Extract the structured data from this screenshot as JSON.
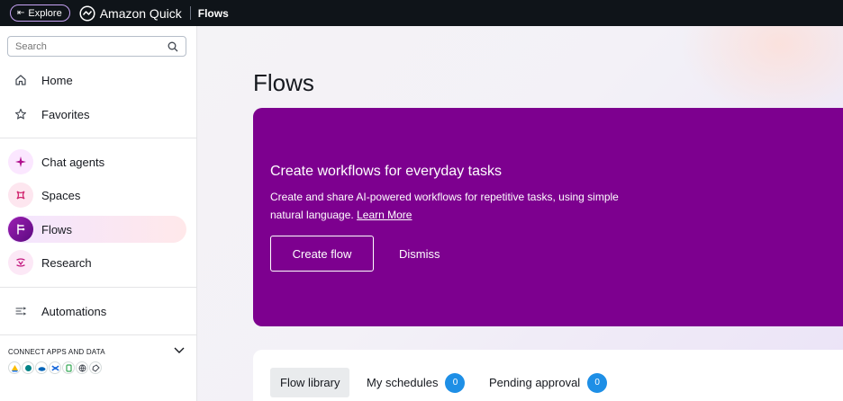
{
  "topbar": {
    "explore_label": "Explore",
    "brand_name": "Amazon Quick",
    "breadcrumb": "Flows"
  },
  "sidebar": {
    "search_placeholder": "Search",
    "items": [
      {
        "label": "Home",
        "icon": "home-icon"
      },
      {
        "label": "Favorites",
        "icon": "star-icon"
      },
      {
        "label": "Chat agents",
        "icon": "sparkle-icon"
      },
      {
        "label": "Spaces",
        "icon": "spaces-icon"
      },
      {
        "label": "Flows",
        "icon": "flows-icon",
        "active": true
      },
      {
        "label": "Research",
        "icon": "research-icon"
      },
      {
        "label": "Automations",
        "icon": "automations-icon"
      }
    ],
    "connect_title": "CONNECT APPS AND DATA",
    "apps": [
      "google-drive-icon",
      "sharepoint-icon",
      "onedrive-icon",
      "confluence-icon",
      "sheet-icon",
      "web-icon",
      "other-icon"
    ]
  },
  "main": {
    "page_title": "Flows",
    "banner": {
      "title": "Create workflows for everyday tasks",
      "description": "Create and share AI-powered workflows for repetitive tasks, using simple natural language.",
      "learn_more": "Learn More",
      "create_button": "Create flow",
      "dismiss_button": "Dismiss",
      "color": "#7d008f"
    },
    "tabs": [
      {
        "label": "Flow library",
        "selected": true
      },
      {
        "label": "My schedules",
        "count": "0"
      },
      {
        "label": "Pending approval",
        "count": "0"
      }
    ]
  },
  "colors": {
    "topbar_bg": "#0f1419",
    "accent_purple": "#7d008f",
    "badge_blue": "#1e8fe6"
  }
}
